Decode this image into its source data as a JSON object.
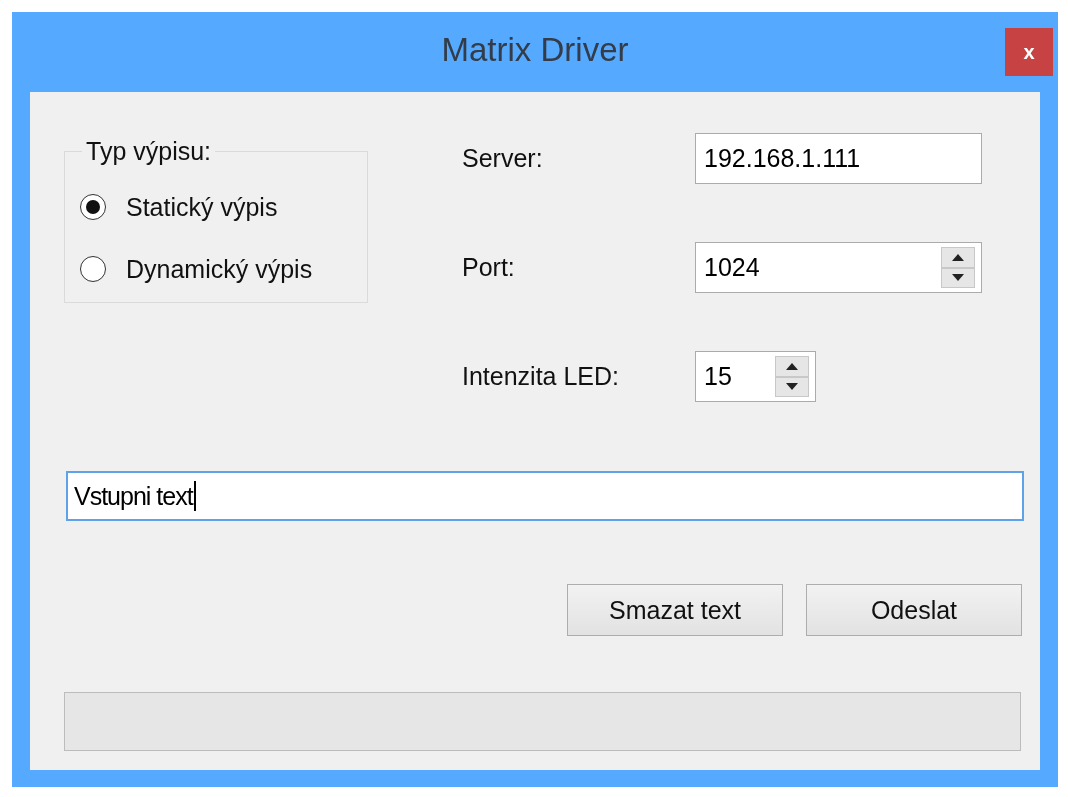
{
  "window": {
    "title": "Matrix Driver",
    "close": "x"
  },
  "mode_group": {
    "title": "Typ výpisu:",
    "options": [
      {
        "label": "Statický výpis",
        "selected": true
      },
      {
        "label": "Dynamický výpis",
        "selected": false
      }
    ]
  },
  "fields": [
    {
      "label": "Server:",
      "value": "192.168.1.111",
      "kind": "text"
    },
    {
      "label": "Port:",
      "value": "1024",
      "kind": "spinner"
    },
    {
      "label": "Intenzita LED:",
      "value": "15",
      "kind": "small_spinner"
    }
  ],
  "input": {
    "value": "Vstupni text",
    "focused": true
  },
  "buttons": [
    "Smazat text",
    "Odeslat"
  ],
  "progress": {
    "level": 0
  }
}
